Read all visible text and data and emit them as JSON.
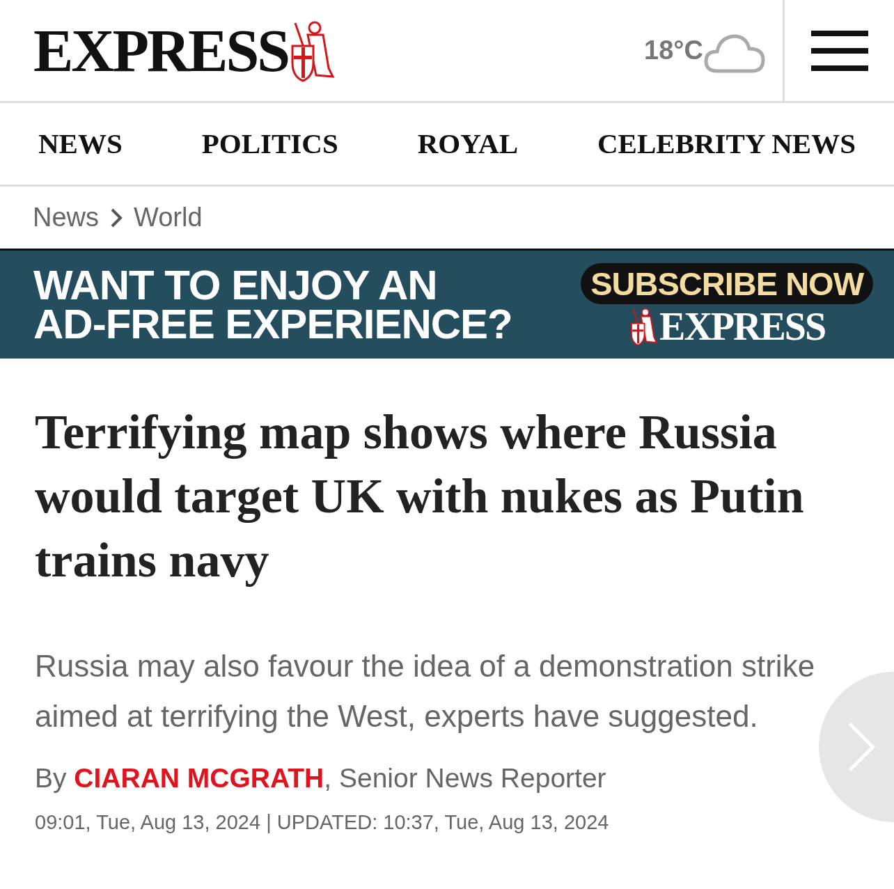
{
  "header": {
    "logo": "EXPRESS",
    "temperature": "18°C"
  },
  "nav": [
    {
      "label": "NEWS"
    },
    {
      "label": "POLITICS"
    },
    {
      "label": "ROYAL"
    },
    {
      "label": "CELEBRITY NEWS"
    }
  ],
  "breadcrumb": [
    "News",
    "World"
  ],
  "banner": {
    "lines": [
      "WANT TO ENJOY AN",
      "AD-FREE EXPERIENCE?"
    ],
    "button": "SUBSCRIBE NOW",
    "logo": "EXPRESS"
  },
  "article": {
    "headline": "Terrifying map shows where Russia would target UK with nukes as Putin trains navy",
    "standfirst": "Russia may also favour the idea of a demonstration strike aimed at terrifying the West, experts have suggested.",
    "byline": {
      "prefix": "By",
      "author": "CIARAN MCGRATH",
      "role": ", Senior News Reporter"
    },
    "timestamp": "09:01, Tue, Aug 13, 2024 | UPDATED: 10:37, Tue, Aug 13, 2024"
  }
}
